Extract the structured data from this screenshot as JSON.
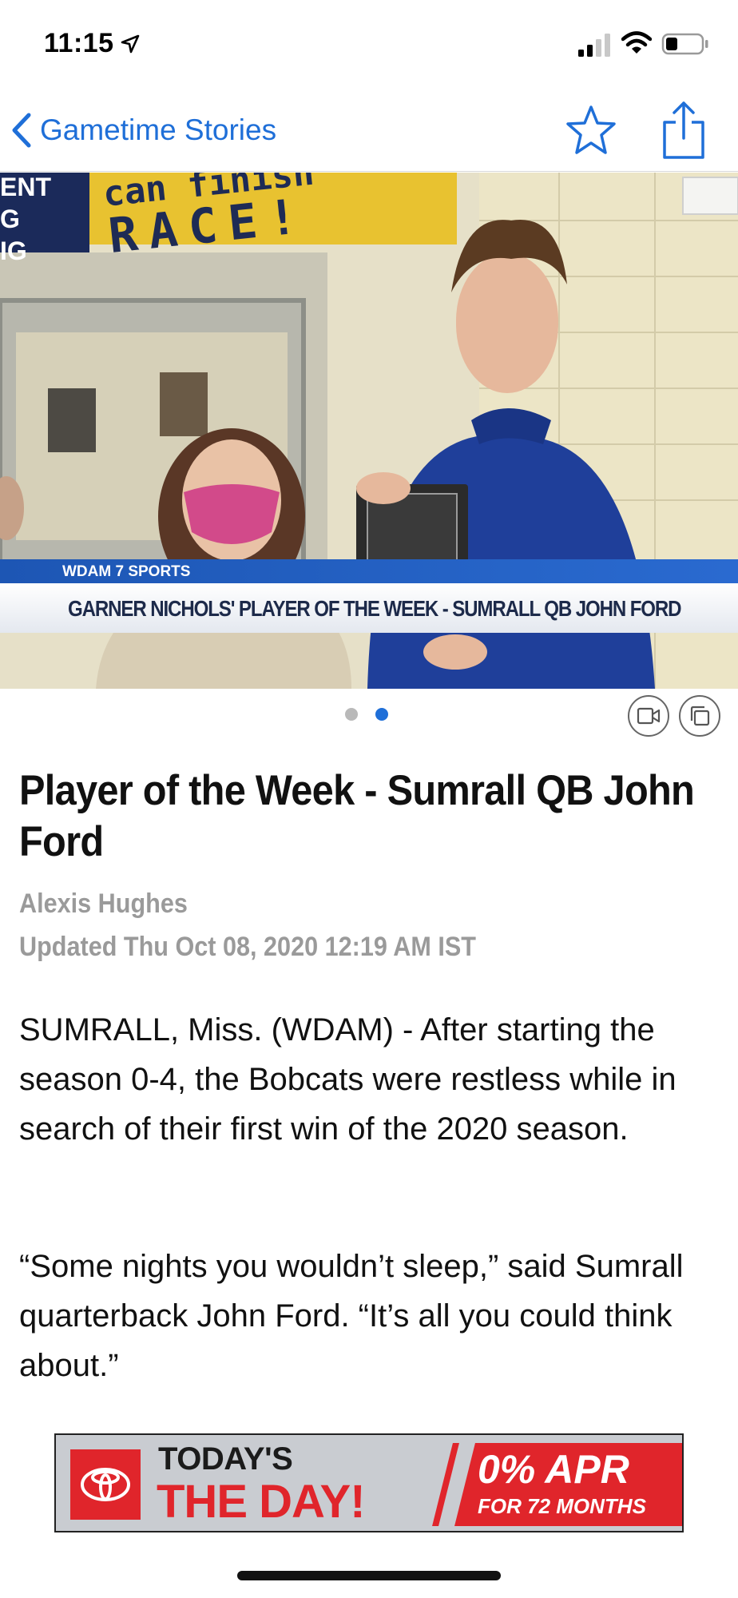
{
  "status_bar": {
    "time": "11:15",
    "icons": [
      "location-arrow-icon",
      "cellular-signal-icon",
      "wifi-icon",
      "battery-icon"
    ]
  },
  "nav": {
    "back_label": "Gametime Stories",
    "accent": "#1f6fd8",
    "icons": [
      "chevron-left-icon",
      "star-icon",
      "share-icon"
    ]
  },
  "hero": {
    "banner_left": [
      "ENT",
      "G",
      "IG"
    ],
    "banner_line1": "can finish",
    "banner_line2": "RACE!",
    "lower_third_tag": "WDAM 7 SPORTS",
    "lower_third_title": "GARNER NICHOLS' PLAYER OF THE WEEK - SUMRALL QB JOHN FORD"
  },
  "carousel": {
    "page_count": 2,
    "active_index": 1,
    "icons": [
      "video-icon",
      "gallery-icon"
    ]
  },
  "article": {
    "headline": "Player of the Week - Sumrall QB John Ford",
    "author": "Alexis Hughes",
    "updated": "Updated Thu Oct 08, 2020 12:19 AM IST",
    "paragraphs": [
      "SUMRALL, Miss. (WDAM) - After starting the season 0-4, the Bobcats were restless while in search of their first win of the 2020 season.",
      "“Some nights you wouldn’t sleep,” said Sumrall quarterback John Ford. “It’s all you could think about.”"
    ]
  },
  "ad": {
    "line1": "TODAY'S",
    "line2": "THE DAY!",
    "offer": "0% APR",
    "offer_terms": "FOR 72 MONTHS",
    "brand_color": "#e0252b"
  }
}
